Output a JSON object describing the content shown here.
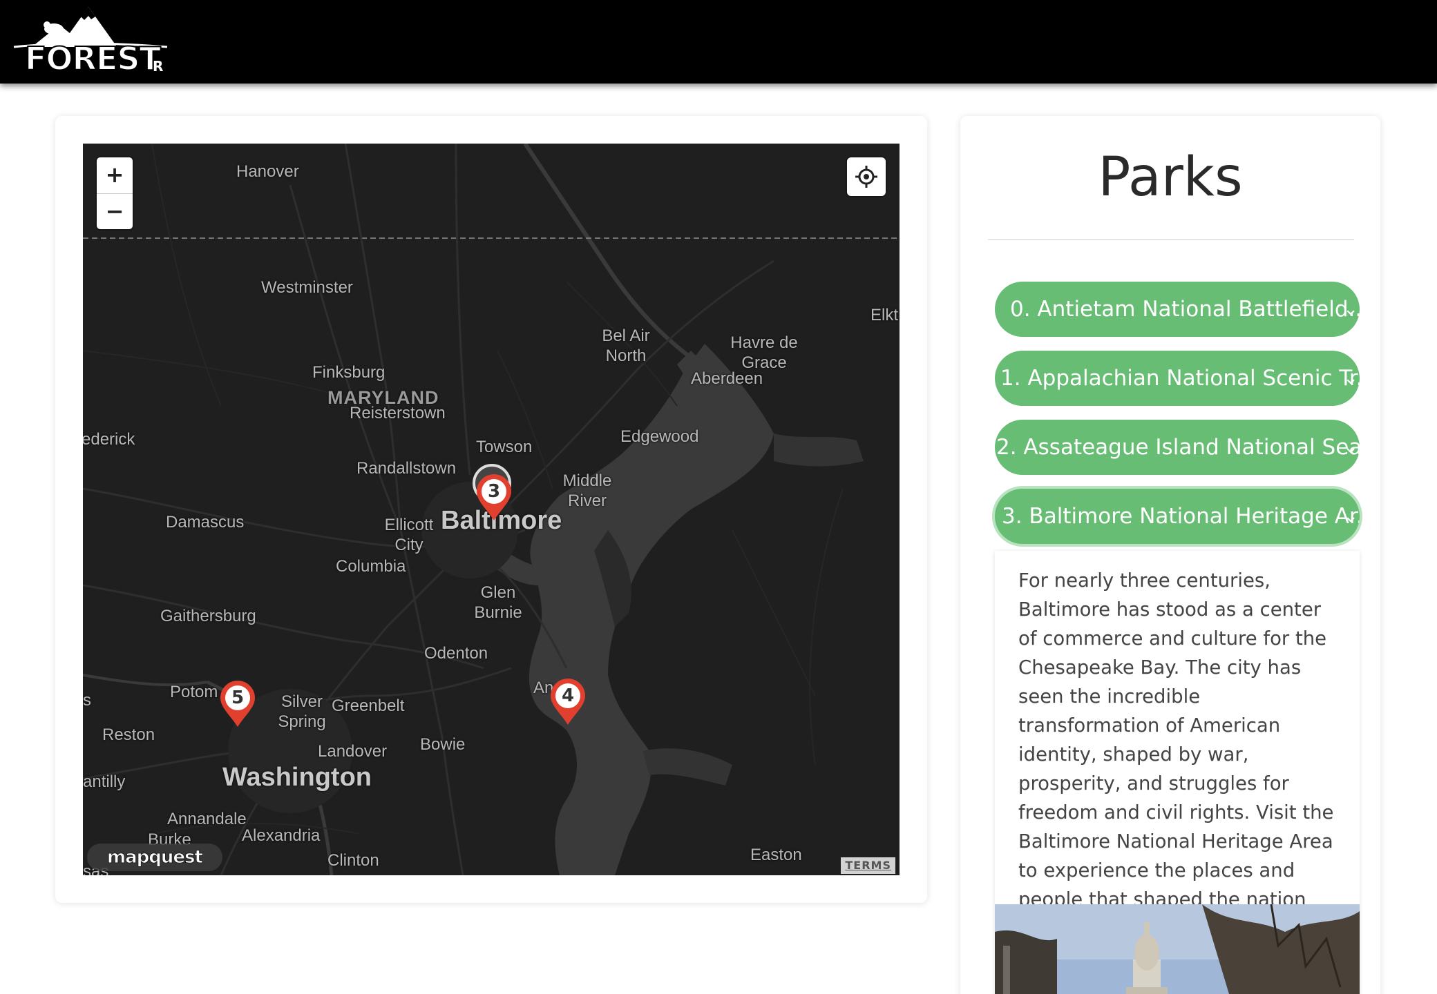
{
  "header": {
    "logo_text": "FOREST",
    "logo_sub": "R"
  },
  "map": {
    "zoom_in_label": "+",
    "zoom_out_label": "−",
    "places": {
      "hanover": "Hanover",
      "westminster": "Westminster",
      "finksburg": "Finksburg",
      "maryland": "MARYLAND",
      "reisterstown": "Reisterstown",
      "frederick": "ederick",
      "towson": "Towson",
      "randallstown": "Randallstown",
      "bel_air_north": "Bel Air North",
      "havre_de_grace": "Havre de Grace",
      "aberdeen": "Aberdeen",
      "elkton": "Elkt",
      "edgewood": "Edgewood",
      "middle_river": "Middle River",
      "damascus": "Damascus",
      "ellicott_city": "Ellicott City",
      "baltimore": "Baltimore",
      "columbia": "Columbia",
      "glen_burnie": "Glen Burnie",
      "gaithersburg": "Gaithersburg",
      "odenton": "Odenton",
      "potomac": "Potom",
      "silver_spring": "Silver Spring",
      "greenbelt": "Greenbelt",
      "annapolis": "An",
      "reston": "Reston",
      "bowie": "Bowie",
      "landover": "Landover",
      "chantilly": "antilly",
      "washington": "Washington",
      "annandale": "Annandale",
      "alexandria": "Alexandria",
      "burke": "Burke",
      "clinton": "Clinton",
      "easton": "Easton",
      "edge_s": "s",
      "edge_sas": "sas"
    },
    "markers": [
      "3",
      "4",
      "5"
    ],
    "brand": "mapquest",
    "terms": "TERMS"
  },
  "parks": {
    "title": "Parks",
    "items": [
      {
        "label": "0. Antietam National Battlefield..."
      },
      {
        "label": "1. Appalachian National Scenic Tr..."
      },
      {
        "label": "2. Assateague Island National Sea..."
      },
      {
        "label": "3. Baltimore National Heritage Ar..."
      }
    ],
    "chevron": "⌄",
    "selected_description": "For nearly three centuries, Baltimore has stood as a center of commerce and culture for the Chesapeake Bay. The city has seen the incredible transformation of American identity, shaped by war, prosperity, and struggles for freedom and civil rights. Visit the Baltimore National Heritage Area to experience the places and people that shaped the nation and forged the American identity."
  },
  "colors": {
    "park_button": "#66bd73",
    "marker_red": "#e2402e",
    "map_land": "#1f1f1f",
    "map_water": "#3a3a3a",
    "header_bg": "#000000"
  }
}
